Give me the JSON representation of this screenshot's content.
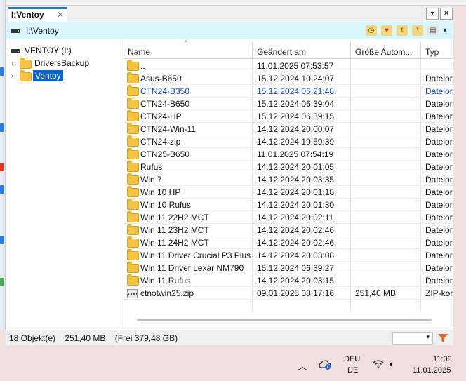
{
  "tab": {
    "title": "I:Ventoy",
    "close_glyph": "✕"
  },
  "window_buttons": {
    "dropdown": "▾",
    "close": "✕"
  },
  "address": {
    "path": "I:\\Ventoy"
  },
  "toolbar": {
    "icons": [
      "history-icon",
      "favorites-icon",
      "tag-icon",
      "filter-icon",
      "layout-icon"
    ],
    "more_glyph": "▾"
  },
  "tree": {
    "root": {
      "label": "VENTOY (I:)"
    },
    "items": [
      {
        "label": "DriversBackup",
        "selected": false
      },
      {
        "label": "Ventoy",
        "selected": true
      }
    ]
  },
  "columns": {
    "name": "Name",
    "modified": "Geändert am",
    "size": "Größe Autom...",
    "type": "Typ"
  },
  "files": [
    {
      "name": "..",
      "modified": "11.01.2025 07:53:57",
      "size": "",
      "type": "",
      "icon": "folder",
      "highlight": false
    },
    {
      "name": "Asus-B650",
      "modified": "15.12.2024 10:24:07",
      "size": "",
      "type": "Dateiordner",
      "icon": "folder",
      "highlight": false
    },
    {
      "name": "CTN24-B350",
      "modified": "15.12.2024 06:21:48",
      "size": "",
      "type": "Dateiordner",
      "icon": "folder",
      "highlight": true
    },
    {
      "name": "CTN24-B650",
      "modified": "15.12.2024 06:39:04",
      "size": "",
      "type": "Dateiordner",
      "icon": "folder",
      "highlight": false
    },
    {
      "name": "CTN24-HP",
      "modified": "15.12.2024 06:39:15",
      "size": "",
      "type": "Dateiordner",
      "icon": "folder",
      "highlight": false
    },
    {
      "name": "CTN24-Win-11",
      "modified": "14.12.2024 20:00:07",
      "size": "",
      "type": "Dateiordner",
      "icon": "folder",
      "highlight": false
    },
    {
      "name": "CTN24-zip",
      "modified": "14.12.2024 19:59:39",
      "size": "",
      "type": "Dateiordner",
      "icon": "folder",
      "highlight": false
    },
    {
      "name": "CTN25-B650",
      "modified": "11.01.2025 07:54:19",
      "size": "",
      "type": "Dateiordner",
      "icon": "folder",
      "highlight": false
    },
    {
      "name": "Rufus",
      "modified": "14.12.2024 20:01:05",
      "size": "",
      "type": "Dateiordner",
      "icon": "folder",
      "highlight": false
    },
    {
      "name": "Win 7",
      "modified": "14.12.2024 20:03:35",
      "size": "",
      "type": "Dateiordner",
      "icon": "folder",
      "highlight": false
    },
    {
      "name": "Win 10 HP",
      "modified": "14.12.2024 20:01:18",
      "size": "",
      "type": "Dateiordner",
      "icon": "folder",
      "highlight": false
    },
    {
      "name": "Win 10 Rufus",
      "modified": "14.12.2024 20:01:30",
      "size": "",
      "type": "Dateiordner",
      "icon": "folder",
      "highlight": false
    },
    {
      "name": "Win 11 22H2 MCT",
      "modified": "14.12.2024 20:02:11",
      "size": "",
      "type": "Dateiordner",
      "icon": "folder",
      "highlight": false
    },
    {
      "name": "Win 11 23H2 MCT",
      "modified": "14.12.2024 20:02:46",
      "size": "",
      "type": "Dateiordner",
      "icon": "folder",
      "highlight": false
    },
    {
      "name": "Win 11 24H2 MCT",
      "modified": "14.12.2024 20:02:46",
      "size": "",
      "type": "Dateiordner",
      "icon": "folder",
      "highlight": false
    },
    {
      "name": "Win 11 Driver Crucial P3 Plus",
      "modified": "14.12.2024 20:03:08",
      "size": "",
      "type": "Dateiordner",
      "icon": "folder",
      "highlight": false
    },
    {
      "name": "Win 11 Driver Lexar NM790",
      "modified": "15.12.2024 06:39:27",
      "size": "",
      "type": "Dateiordner",
      "icon": "folder",
      "highlight": false
    },
    {
      "name": "Win 11 Rufus",
      "modified": "14.12.2024 20:03:15",
      "size": "",
      "type": "Dateiordner",
      "icon": "folder",
      "highlight": false
    },
    {
      "name": "ctnotwin25.zip",
      "modified": "09.01.2025 08:17:16",
      "size": "251,40 MB",
      "type": "ZIP-komprimierter Ordner",
      "icon": "zip",
      "highlight": false
    }
  ],
  "status": {
    "text": "18 Objekt(e)    251,40 MB    (Frei 379,48 GB)"
  },
  "taskbar": {
    "lang_top": "DEU",
    "lang_bottom": "DE",
    "time": "11:09",
    "date": "11.01.2025",
    "chevron_glyph": "︿",
    "speaker_glyph": "🔈︎"
  },
  "colors": {
    "accent": "#2d6fcb",
    "highlight_text": "#1a3fd6",
    "selection": "#0a63d6",
    "address_bg": "#d9f6fb",
    "folder": "#f6c445",
    "funnel": "#e8632b"
  }
}
